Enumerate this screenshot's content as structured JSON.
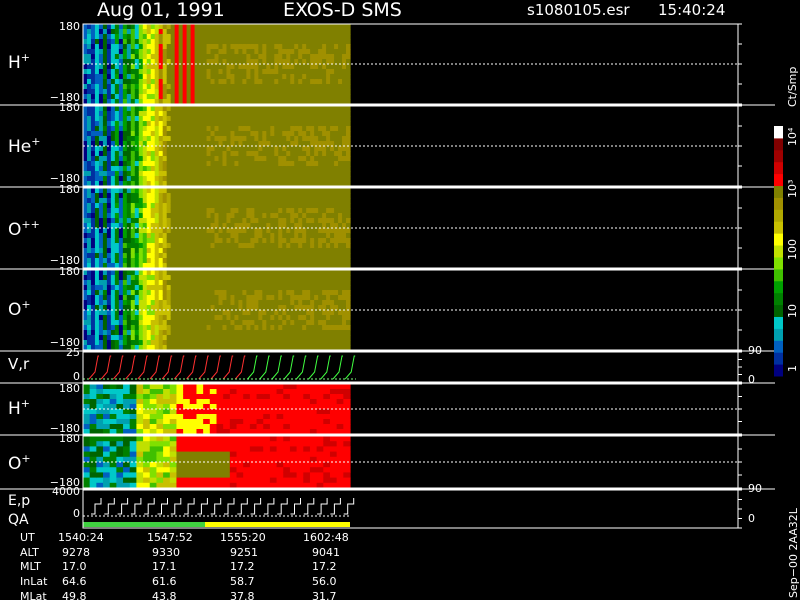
{
  "header": {
    "date": "Aug 01, 1991",
    "instrument": "EXOS-D SMS",
    "file": "s1080105.esr",
    "time": "15:40:24"
  },
  "colorbar": {
    "unit": "Ct/Smp",
    "ticks": [
      "1",
      "10",
      "100",
      "10³",
      "10⁴"
    ],
    "colors": [
      "#000080",
      "#0030a0",
      "#0060c0",
      "#00a0b0",
      "#00c8c8",
      "#006400",
      "#008000",
      "#00a000",
      "#40c000",
      "#80e000",
      "#c0e000",
      "#ffff00",
      "#c8c000",
      "#b0a800",
      "#a09000",
      "#808000",
      "#ff0000",
      "#d00000",
      "#a00000",
      "#800000",
      "#ffffff"
    ]
  },
  "panels": {
    "h_plus": {
      "label": "H",
      "sup": "+",
      "ymax": "180",
      "ymin": "−180"
    },
    "he_plus": {
      "label": "He",
      "sup": "+",
      "ymax": "180",
      "ymin": "−180"
    },
    "o_pp": {
      "label": "O",
      "sup": "++",
      "ymax": "180",
      "ymin": "−180"
    },
    "o_plus": {
      "label": "O",
      "sup": "+",
      "ymax": "180",
      "ymin": "−180"
    },
    "vr": {
      "label": "V,r",
      "ymax": "25",
      "ymin": "0",
      "rmax": "90",
      "rmin": "0"
    },
    "h_plus2": {
      "label": "H",
      "sup": "+",
      "ymax": "180",
      "ymin": "−180"
    },
    "o_plus2": {
      "label": "O",
      "sup": "+",
      "ymax": "180",
      "ymin": "−180"
    },
    "ep": {
      "label1": "E,p",
      "label2": "QA",
      "ymax": "4000",
      "ymin": "0",
      "rmax": "90",
      "rmin": "0"
    }
  },
  "footer": {
    "rows": [
      {
        "label": "UT",
        "values": [
          "1540:24",
          "1547:52",
          "1555:20",
          "1602:48"
        ]
      },
      {
        "label": "ALT",
        "values": [
          "9278",
          "9330",
          "9251",
          "9041"
        ]
      },
      {
        "label": "MLT",
        "values": [
          "17.0",
          "17.1",
          "17.2",
          "17.2"
        ]
      },
      {
        "label": "InLat",
        "values": [
          "64.6",
          "61.6",
          "58.7",
          "56.0"
        ]
      },
      {
        "label": "MLat",
        "values": [
          "49.8",
          "43.8",
          "37.8",
          "31.7"
        ]
      }
    ],
    "side_note": "Sep−00 2AA32L"
  },
  "chart_data": {
    "type": "heatmap",
    "title": "Aug 01, 1991 EXOS-D SMS",
    "x": [
      "1540:24",
      "1547:52",
      "1555:20",
      "1602:48"
    ],
    "panels": [
      "H+",
      "He+",
      "O++",
      "O+",
      "V,r",
      "H+",
      "O+",
      "E,p"
    ],
    "ylim": [
      -180,
      180
    ],
    "colorbar_unit": "Ct/Smp",
    "colorbar_range": [
      1,
      10000
    ],
    "colorbar_scale": "log",
    "colorbar_ticks": [
      1,
      10,
      100,
      1000,
      10000
    ],
    "colorbar_colors": [
      "#000080",
      "#0030a0",
      "#0060c0",
      "#00a0b0",
      "#00c8c8",
      "#006400",
      "#008000",
      "#00a000",
      "#40c000",
      "#80e000",
      "#c0e000",
      "#ffff00",
      "#c8c000",
      "#b0a800",
      "#a09000",
      "#808000",
      "#ff0000",
      "#d00000",
      "#a00000",
      "#800000",
      "#ffffff"
    ]
  }
}
